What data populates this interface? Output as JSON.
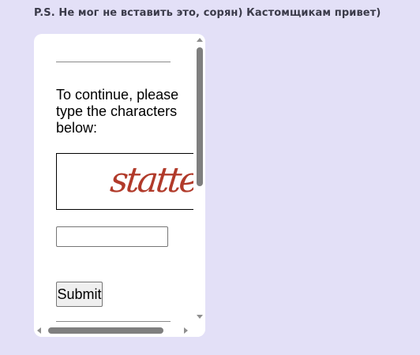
{
  "note": {
    "text": "P.S. Не мог не вставить это, сорян) Кастомщикам привет)"
  },
  "captcha_frame": {
    "prompt": "To continue, please type the characters below:",
    "captcha_image_text": "statte",
    "answer_input": {
      "value": "",
      "placeholder": ""
    },
    "submit_label": "Submit"
  },
  "scrollbars": {
    "vertical_position": 0.0,
    "horizontal_position": 0.0
  },
  "colors": {
    "page_background": "#e3e0f7",
    "card_background": "#ffffff",
    "note_text": "#3b3b4a",
    "captcha_ink": "#b13a2a",
    "scrollbar_thumb": "#7f7f7f"
  },
  "icons": {
    "scroll_up": "triangle-up-icon",
    "scroll_down": "triangle-down-icon",
    "scroll_left": "triangle-left-icon",
    "scroll_right": "triangle-right-icon"
  }
}
